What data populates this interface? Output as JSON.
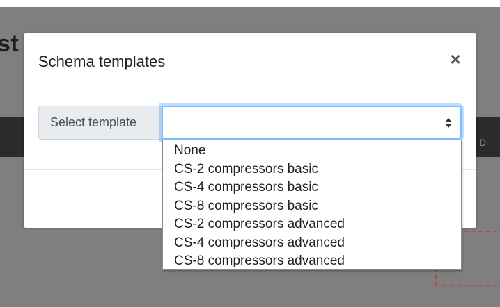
{
  "background": {
    "title_fragment": "st",
    "nav_letter": "D"
  },
  "modal": {
    "title": "Schema templates",
    "close_label": "×",
    "template_select": {
      "label": "Select template",
      "value": "",
      "options": [
        "None",
        "CS-2 compressors basic",
        "CS-4 compressors basic",
        "CS-8 compressors basic",
        "CS-2 compressors advanced",
        "CS-4 compressors advanced",
        "CS-8 compressors advanced"
      ]
    }
  },
  "icons": {
    "close": "close-icon",
    "select_arrows": "chevron-up-down-icon"
  },
  "colors": {
    "focus_border": "#80bdff",
    "backdrop": "#7f7f7f",
    "navbar": "#2b2b2b",
    "dashed_accent": "#b24b4b"
  }
}
